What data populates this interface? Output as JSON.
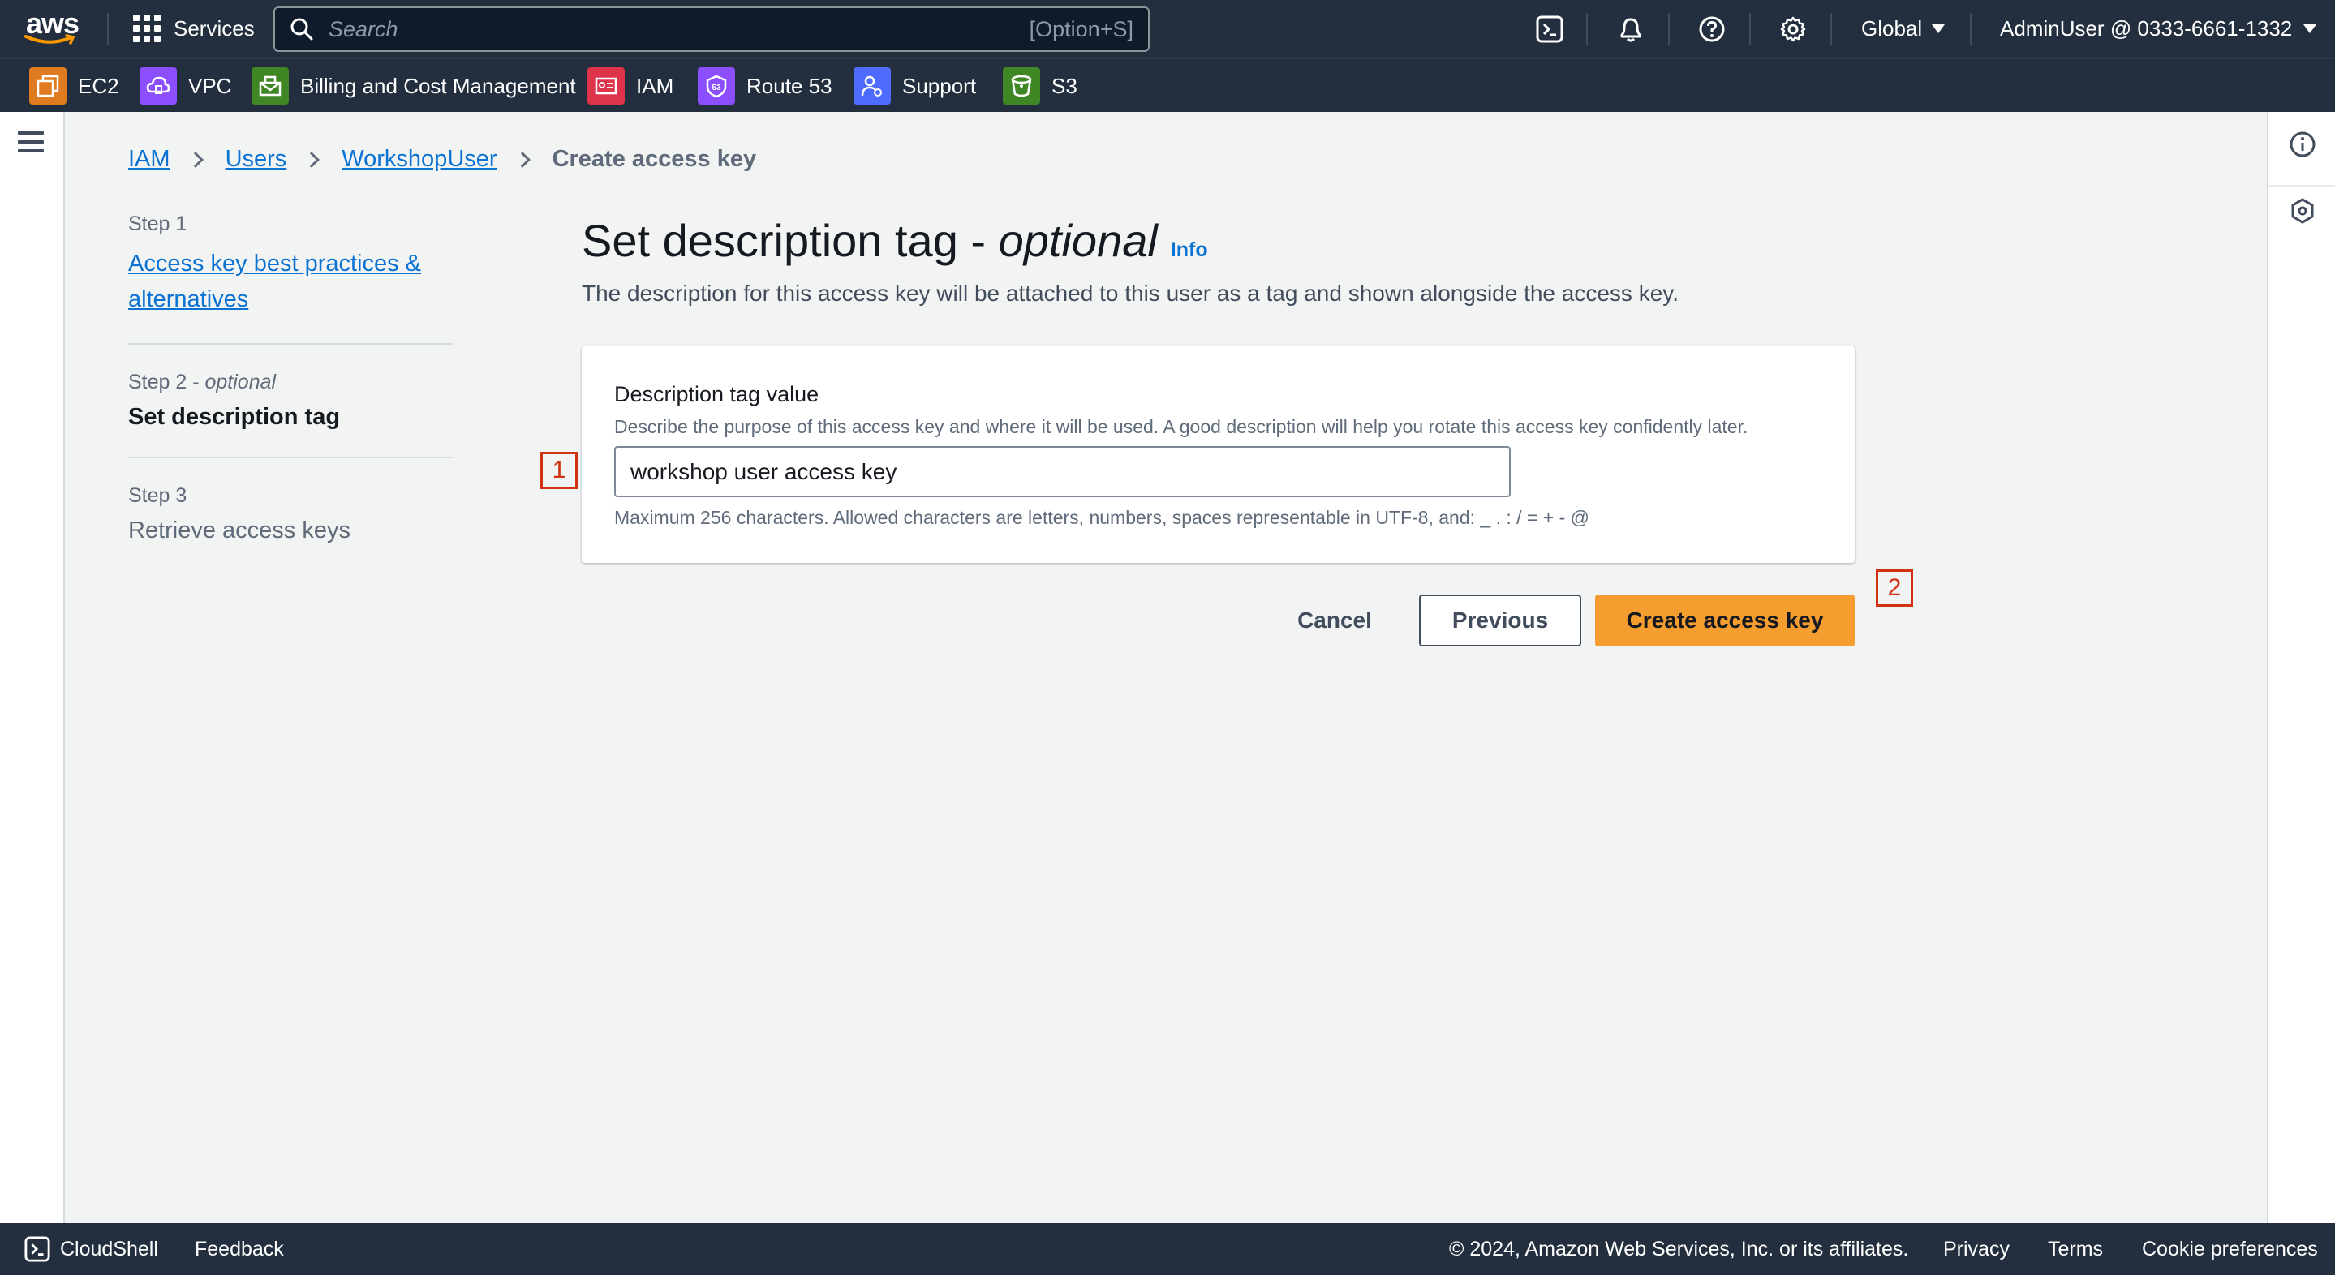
{
  "topbar": {
    "logo_text": "aws",
    "services_label": "Services",
    "search_placeholder": "Search",
    "search_shortcut": "[Option+S]",
    "region_label": "Global",
    "account_label": "AdminUser @ 0333-6661-1332",
    "icons": [
      "cloudshell-icon",
      "bell-icon",
      "help-icon",
      "settings-icon"
    ]
  },
  "favorites": [
    {
      "label": "EC2",
      "color": "#e07b1f",
      "icon": "ec2-icon"
    },
    {
      "label": "VPC",
      "color": "#8c4fff",
      "icon": "vpc-icon"
    },
    {
      "label": "Billing and Cost Management",
      "color": "#3f8624",
      "icon": "billing-icon"
    },
    {
      "label": "IAM",
      "color": "#dd344c",
      "icon": "iam-icon"
    },
    {
      "label": "Route 53",
      "color": "#8c4fff",
      "icon": "route53-icon"
    },
    {
      "label": "Support",
      "color": "#4d6bfe",
      "icon": "support-icon"
    },
    {
      "label": "S3",
      "color": "#3f8624",
      "icon": "s3-icon"
    }
  ],
  "breadcrumb": {
    "items": [
      "IAM",
      "Users",
      "WorkshopUser"
    ],
    "current": "Create access key"
  },
  "steps": [
    {
      "num": "Step 1",
      "label": "Access key best practices &",
      "label2": "alternatives"
    },
    {
      "num": "Step 2",
      "num_suffix": " - ",
      "num_optional": "optional",
      "label": "Set description tag"
    },
    {
      "num": "Step 3",
      "label": "Retrieve access keys"
    }
  ],
  "main": {
    "title": "Set description tag - ",
    "title_optional": "optional",
    "info_link": "Info",
    "description": "The description for this access key will be attached to this user as a tag and shown alongside the access key.",
    "field_label": "Description tag value",
    "field_description": "Describe the purpose of this access key and where it will be used. A good description will help you rotate this access key confidently later.",
    "field_value": "workshop user access key",
    "field_constraint": "Maximum 256 characters. Allowed characters are letters, numbers, spaces representable in UTF-8, and: _ . : / = + - @"
  },
  "actions": {
    "cancel": "Cancel",
    "previous": "Previous",
    "create": "Create access key"
  },
  "markers": {
    "one": "1",
    "two": "2"
  },
  "footer": {
    "cloudshell": "CloudShell",
    "feedback": "Feedback",
    "copyright": "© 2024, Amazon Web Services, Inc. or its affiliates.",
    "privacy": "Privacy",
    "terms": "Terms",
    "cookies": "Cookie preferences"
  },
  "colors": {
    "nav_bg": "#232f3e",
    "link": "#0972d3",
    "primary_button": "#f59e2f",
    "marker": "#d13212"
  }
}
